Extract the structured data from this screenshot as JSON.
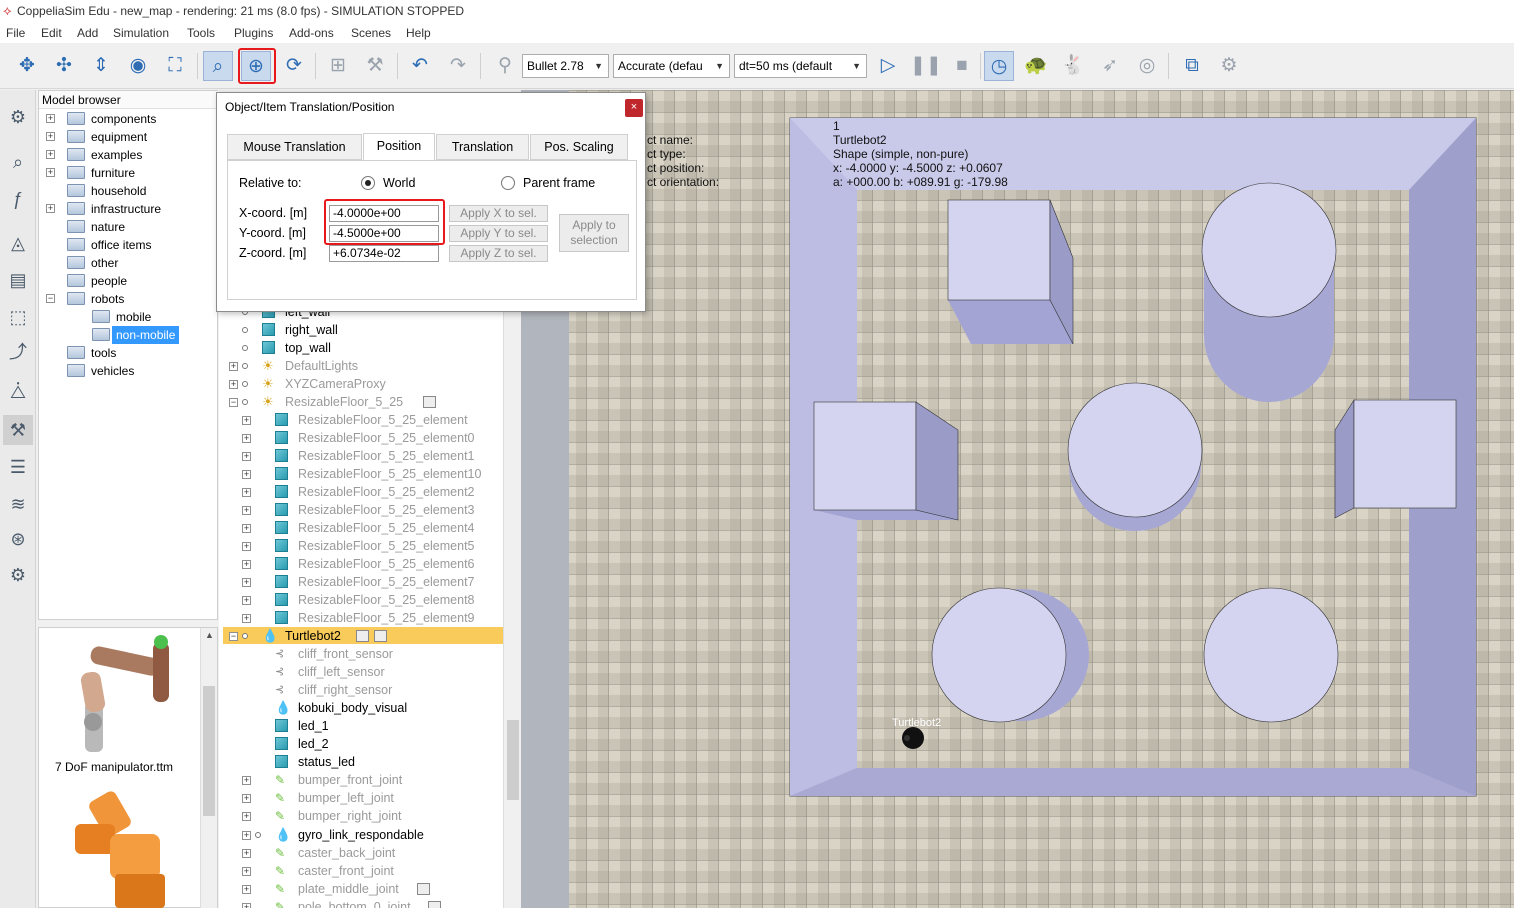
{
  "window": {
    "title": "CoppeliaSim Edu - new_map - rendering: 21 ms (8.0 fps) - SIMULATION STOPPED"
  },
  "menu": [
    "File",
    "Edit",
    "Add",
    "Simulation",
    "Tools",
    "Plugins",
    "Add-ons",
    "Scenes",
    "Help"
  ],
  "toolbar": {
    "engine": "Bullet 2.78",
    "accuracy": "Accurate (defau",
    "timestep": "dt=50 ms (default"
  },
  "model_browser": {
    "title": "Model browser",
    "folders": [
      {
        "label": "components",
        "expander": "+"
      },
      {
        "label": "equipment",
        "expander": "+"
      },
      {
        "label": "examples",
        "expander": "+"
      },
      {
        "label": "furniture",
        "expander": "+"
      },
      {
        "label": "household",
        "expander": ""
      },
      {
        "label": "infrastructure",
        "expander": "+"
      },
      {
        "label": "nature",
        "expander": ""
      },
      {
        "label": "office items",
        "expander": ""
      },
      {
        "label": "other",
        "expander": ""
      },
      {
        "label": "people",
        "expander": ""
      },
      {
        "label": "robots",
        "expander": "−"
      },
      {
        "label": "mobile",
        "expander": ""
      },
      {
        "label": "non-mobile",
        "expander": ""
      },
      {
        "label": "tools",
        "expander": ""
      },
      {
        "label": "vehicles",
        "expander": ""
      }
    ],
    "thumbnail_caption": "7 DoF manipulator.ttm"
  },
  "scene_tree": [
    {
      "label": "left_wall",
      "icon": "cube",
      "dim": false
    },
    {
      "label": "right_wall",
      "icon": "cube",
      "dim": false
    },
    {
      "label": "top_wall",
      "icon": "cube",
      "dim": false
    },
    {
      "label": "DefaultLights",
      "icon": "light",
      "dim": true
    },
    {
      "label": "XYZCameraProxy",
      "icon": "light",
      "dim": true
    },
    {
      "label": "ResizableFloor_5_25",
      "icon": "light",
      "dim": true
    },
    {
      "label": "ResizableFloor_5_25_element",
      "icon": "cube",
      "dim": true
    },
    {
      "label": "ResizableFloor_5_25_element0",
      "icon": "cube",
      "dim": true
    },
    {
      "label": "ResizableFloor_5_25_element1",
      "icon": "cube",
      "dim": true
    },
    {
      "label": "ResizableFloor_5_25_element10",
      "icon": "cube",
      "dim": true
    },
    {
      "label": "ResizableFloor_5_25_element2",
      "icon": "cube",
      "dim": true
    },
    {
      "label": "ResizableFloor_5_25_element3",
      "icon": "cube",
      "dim": true
    },
    {
      "label": "ResizableFloor_5_25_element4",
      "icon": "cube",
      "dim": true
    },
    {
      "label": "ResizableFloor_5_25_element5",
      "icon": "cube",
      "dim": true
    },
    {
      "label": "ResizableFloor_5_25_element6",
      "icon": "cube",
      "dim": true
    },
    {
      "label": "ResizableFloor_5_25_element7",
      "icon": "cube",
      "dim": true
    },
    {
      "label": "ResizableFloor_5_25_element8",
      "icon": "cube",
      "dim": true
    },
    {
      "label": "ResizableFloor_5_25_element9",
      "icon": "cube",
      "dim": true
    },
    {
      "label": "Turtlebot2",
      "icon": "drop",
      "dim": false
    },
    {
      "label": "cliff_front_sensor",
      "icon": "sensor",
      "dim": true
    },
    {
      "label": "cliff_left_sensor",
      "icon": "sensor",
      "dim": true
    },
    {
      "label": "cliff_right_sensor",
      "icon": "sensor",
      "dim": true
    },
    {
      "label": "kobuki_body_visual",
      "icon": "drop",
      "dim": false
    },
    {
      "label": "led_1",
      "icon": "cube",
      "dim": false
    },
    {
      "label": "led_2",
      "icon": "cube",
      "dim": false
    },
    {
      "label": "status_led",
      "icon": "cube",
      "dim": false
    },
    {
      "label": "bumper_front_joint",
      "icon": "joint",
      "dim": true
    },
    {
      "label": "bumper_left_joint",
      "icon": "joint",
      "dim": true
    },
    {
      "label": "bumper_right_joint",
      "icon": "joint",
      "dim": true
    },
    {
      "label": "gyro_link_respondable",
      "icon": "drop",
      "dim": false
    },
    {
      "label": "caster_back_joint",
      "icon": "joint",
      "dim": true
    },
    {
      "label": "caster_front_joint",
      "icon": "joint",
      "dim": true
    },
    {
      "label": "plate_middle_joint",
      "icon": "joint",
      "dim": true
    },
    {
      "label": "pole_bottom_0_joint",
      "icon": "joint",
      "dim": true
    }
  ],
  "dialog": {
    "title": "Object/Item Translation/Position",
    "close": "×",
    "tabs": [
      "Mouse Translation",
      "Position",
      "Translation",
      "Pos. Scaling"
    ],
    "relative_to_label": "Relative to:",
    "world_label": "World",
    "parent_label": "Parent frame",
    "x_label": "X-coord. [m]",
    "y_label": "Y-coord. [m]",
    "z_label": "Z-coord. [m]",
    "x_value": "-4.0000e+00",
    "y_value": "-4.5000e+00",
    "z_value": "+6.0734e-02",
    "apply_x": "Apply X to sel.",
    "apply_y": "Apply Y to sel.",
    "apply_z": "Apply Z to sel.",
    "apply_sel_1": "Apply to",
    "apply_sel_2": "selection"
  },
  "viewport_info": {
    "labels": [
      "ct name:",
      "ct type:",
      "ct position:",
      "ct orientation:"
    ],
    "id": "1",
    "name": "Turtlebot2",
    "type": "Shape (simple, non-pure)",
    "position": "x: -4.0000   y: -4.5000    z: +0.0607",
    "orientation": "a: +000.00   b: +089.91    g: -179.98",
    "robot_label": "Turtlebot2"
  },
  "colors": {
    "accent": "#2e6db4",
    "highlight": "#f9cb5a",
    "selection": "#3399ff",
    "wall": "#b7b7dc",
    "redbox": "#e8191c"
  }
}
